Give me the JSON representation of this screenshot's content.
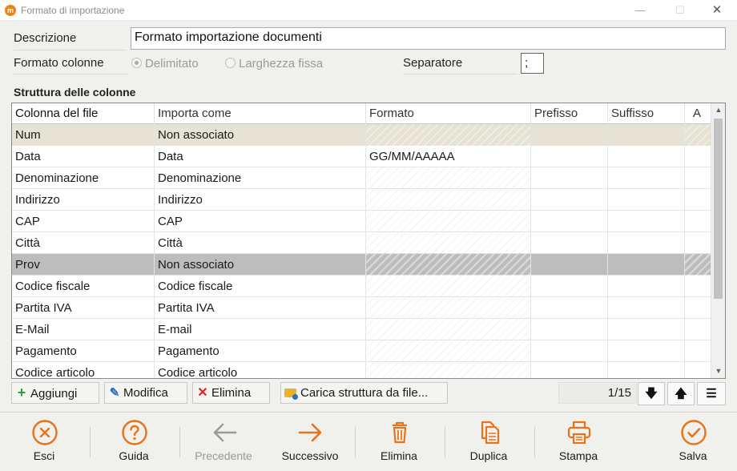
{
  "window": {
    "app_icon": "app-logo-icon",
    "title": "Formato di importazione",
    "controls": {
      "minimize": "—",
      "maximize": "☐",
      "close": "✕"
    }
  },
  "form": {
    "descrizione_label": "Descrizione",
    "descrizione_value": "Formato importazione documenti",
    "formato_colonne_label": "Formato colonne",
    "radio_delimitato": "Delimitato",
    "radio_larghezza_fissa": "Larghezza fissa",
    "selected_radio": "Delimitato",
    "separatore_label": "Separatore",
    "separatore_value": ";"
  },
  "grid": {
    "section_title": "Struttura delle colonne",
    "headers": [
      "Colonna del file",
      "Importa come",
      "Formato",
      "Prefisso",
      "Suffisso",
      "A"
    ],
    "rows": [
      {
        "colonna": "Num",
        "importa": "Non associato",
        "formato": "",
        "state": "selected-light"
      },
      {
        "colonna": "Data",
        "importa": "Data",
        "formato": "GG/MM/AAAAA",
        "state": "normal"
      },
      {
        "colonna": "Denominazione",
        "importa": "Denominazione",
        "formato": "",
        "state": "normal"
      },
      {
        "colonna": "Indirizzo",
        "importa": "Indirizzo",
        "formato": "",
        "state": "normal"
      },
      {
        "colonna": "CAP",
        "importa": "CAP",
        "formato": "",
        "state": "normal"
      },
      {
        "colonna": "Città",
        "importa": "Città",
        "formato": "",
        "state": "normal"
      },
      {
        "colonna": "Prov",
        "importa": "Non associato",
        "formato": "",
        "state": "selected-dark"
      },
      {
        "colonna": "Codice fiscale",
        "importa": "Codice fiscale",
        "formato": "",
        "state": "normal"
      },
      {
        "colonna": "Partita IVA",
        "importa": "Partita IVA",
        "formato": "",
        "state": "normal"
      },
      {
        "colonna": "E-Mail",
        "importa": "E-mail",
        "formato": "",
        "state": "normal"
      },
      {
        "colonna": "Pagamento",
        "importa": "Pagamento",
        "formato": "",
        "state": "normal"
      },
      {
        "colonna": "Codice articolo",
        "importa": "Codice articolo",
        "formato": "",
        "state": "normal"
      }
    ]
  },
  "toolbar": {
    "aggiungi": "Aggiungi",
    "modifica": "Modifica",
    "elimina": "Elimina",
    "carica": "Carica struttura da file...",
    "pager": "1/15",
    "move_down": "🡇",
    "move_up": "🡅",
    "menu": "☰"
  },
  "footer": {
    "esci": "Esci",
    "guida": "Guida",
    "precedente": "Precedente",
    "successivo": "Successivo",
    "elimina": "Elimina",
    "duplica": "Duplica",
    "stampa": "Stampa",
    "salva": "Salva"
  },
  "colors": {
    "accent_orange": "#e8731a",
    "disabled_gray": "#999999",
    "row_selected_light": "#e6e3d4",
    "row_selected_dark": "#bdbdbd"
  }
}
